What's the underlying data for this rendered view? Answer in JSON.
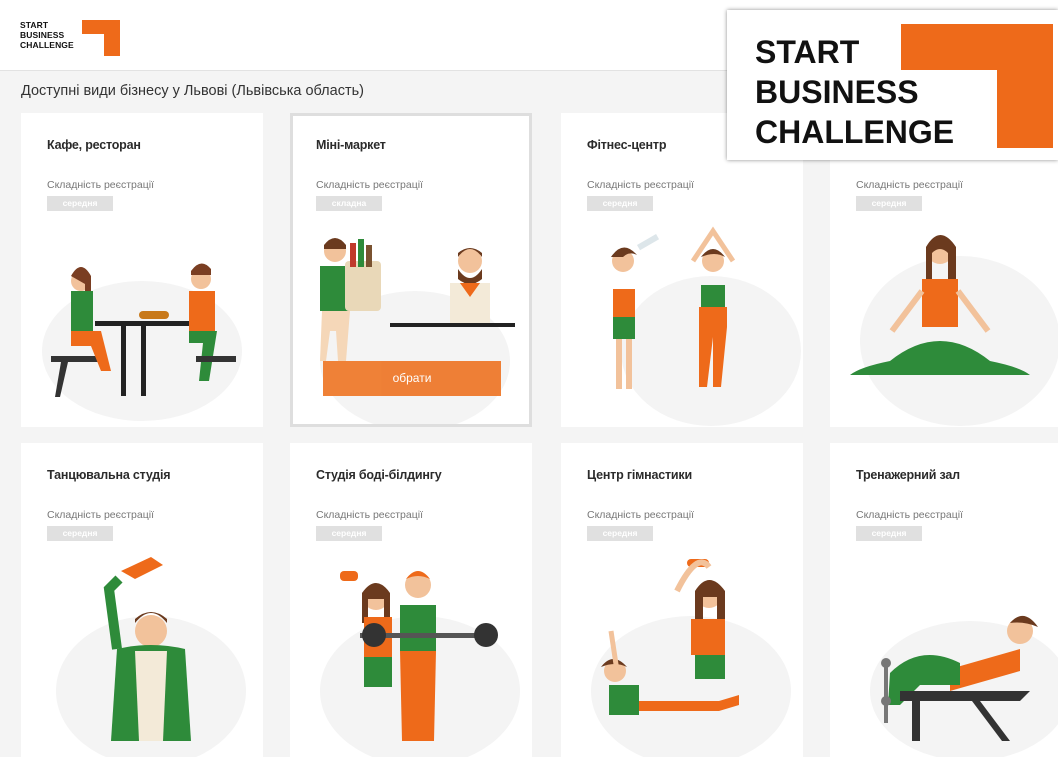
{
  "header": {
    "logo_lines": [
      "START",
      "BUSINESS",
      "CHALLENGE"
    ]
  },
  "page_title": "Доступні види бізнесу у Львові (Львівська область)",
  "overlay_logo": {
    "lines": [
      "START",
      "BUSINESS",
      "CHALLENGE"
    ]
  },
  "colors": {
    "accent": "#ee6a1a",
    "green": "#2e8b3a",
    "badge": "#e0e0e0"
  },
  "cards": [
    {
      "title": "Кафе, ресторан",
      "label": "Складність реєстрації",
      "badge": "середня",
      "illustration": "cafe-couple"
    },
    {
      "title": "Міні-маркет",
      "label": "Складність реєстрації",
      "badge": "складна",
      "illustration": "shop-cashier",
      "selected": true,
      "button": "обрати"
    },
    {
      "title": "Фітнес-центр",
      "label": "Складність реєстрації",
      "badge": "середня",
      "illustration": "fitness-women"
    },
    {
      "title": "",
      "label": "Складність реєстрації",
      "badge": "середня",
      "illustration": "yoga-woman"
    },
    {
      "title": "Танцювальна студія",
      "label": "Складність реєстрації",
      "badge": "середня",
      "illustration": "dancer-hat"
    },
    {
      "title": "Студія боді-білдингу",
      "label": "Складність реєстрації",
      "badge": "середня",
      "illustration": "bodybuilders"
    },
    {
      "title": "Центр гімнастики",
      "label": "Складність реєстрації",
      "badge": "середня",
      "illustration": "gymnasts"
    },
    {
      "title": "Тренажерний зал",
      "label": "Складність реєстрації",
      "badge": "середня",
      "illustration": "bench-workout"
    }
  ]
}
